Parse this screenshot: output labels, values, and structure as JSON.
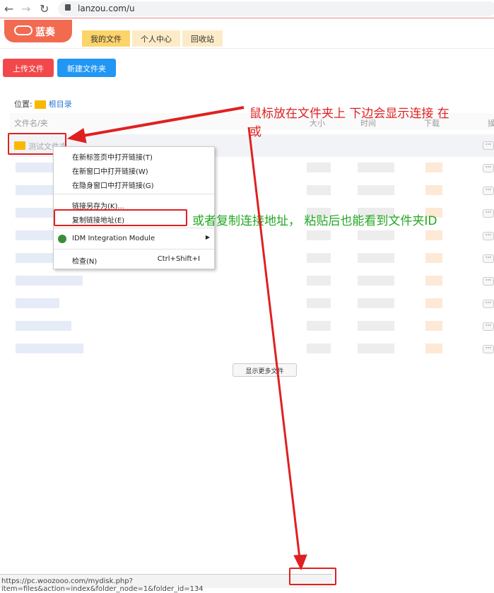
{
  "browser": {
    "url": "lanzou.com/u"
  },
  "header": {
    "logo": "蓝奏",
    "tabs": [
      "我的文件",
      "个人中心",
      "回收站"
    ]
  },
  "toolbar": {
    "upload": "上传文件",
    "new_folder": "新建文件夹"
  },
  "breadcrumb": {
    "label": "位置:",
    "root": "根目录"
  },
  "table": {
    "columns": [
      "文件名/夹",
      "大小",
      "时间",
      "下载",
      "操"
    ],
    "first_row": "测试文件夹",
    "more_button": "···",
    "show_more": "显示更多文件"
  },
  "context_menu": {
    "items": [
      "在新标签页中打开链接(T)",
      "在新窗口中打开链接(W)",
      "在隐身窗口中打开链接(G)",
      "链接另存为(K)...",
      "复制链接地址(E)",
      "IDM Integration Module",
      "检查(N)"
    ],
    "inspect_shortcut": "Ctrl+Shift+I"
  },
  "annotations": {
    "top": "鼠标放在文件夹上  下边会显示连接  在",
    "top2": "或",
    "middle": "或者复制连接地址， 粘贴后也能看到文件夹ID"
  },
  "status_bar": {
    "url": "https://pc.woozooo.com/mydisk.php?item=files&action=index&folder_node=1&folder_id=134"
  },
  "colors": {
    "red": "#e02020",
    "green": "#22a822",
    "upload": "#f2484b",
    "new_folder": "#2196f3"
  }
}
